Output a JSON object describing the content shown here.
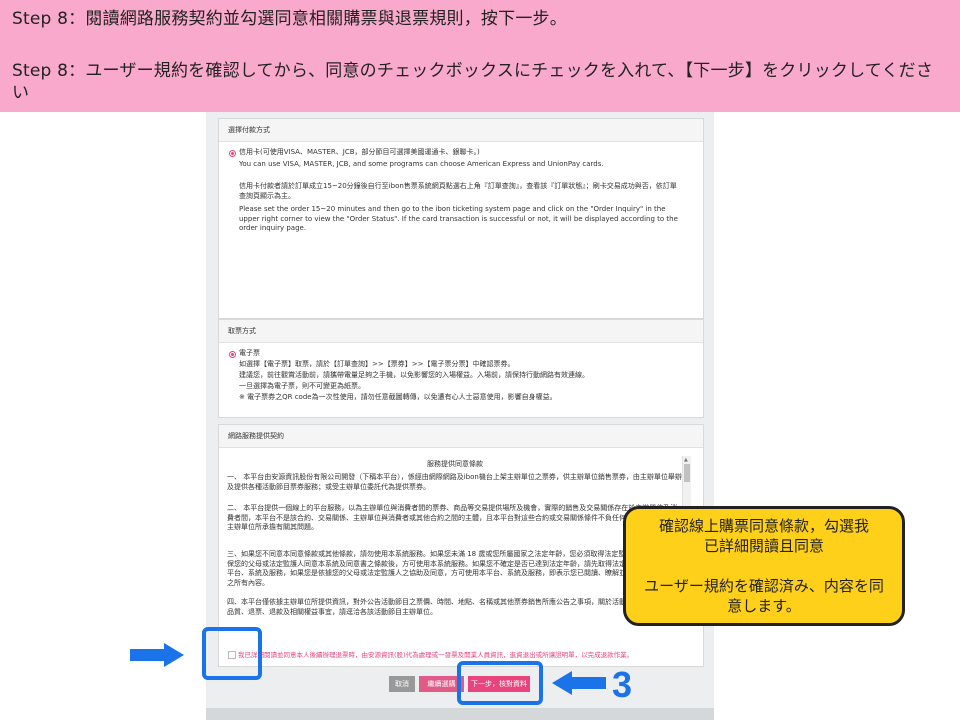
{
  "banner": {
    "line_zh": "Step 8：閱讀網路服務契約並勾選同意相關購票與退票規則，按下一步。",
    "line_ja": "Step 8：ユーザー規約を確認してから、同意のチェックボックスにチェックを入れて、【下一步】をクリックしてください"
  },
  "payment": {
    "header": "選擇付款方式",
    "option_label": "信用卡(可使用VISA、MASTER、JCB，部分節目可選擇美國運通卡、銀聯卡。)",
    "note_en": "You can use VISA, MASTER, JCB, and some programs can choose American Express and UnionPay cards.",
    "note_zh": "信用卡付款者請於訂單成立15~20分鐘後自行至ibon售票系統網頁點選右上角『訂單查詢』，查看該『訂單狀態』；刷卡交易成功與否，依訂單查詢頁顯示為主。",
    "note_en2": "Please set the order 15~20 minutes and then go to the ibon ticketing system page and click on the \"Order Inquiry\" in the upper right corner to view the \"Order Status\". If the card transaction is successful or not, it will be displayed according to the order inquiry page."
  },
  "pickup": {
    "header": "取票方式",
    "option_label": "電子票",
    "line1": "如選擇【電子票】取票，請於【訂單查詢】>>【票券】>>【電子票分票】中確認票券。",
    "line2": "建議您，前往觀賞活動前，請攜帶電量足夠之手機，以免影響您的入場權益。入場前，請保持行動網路有效連線。",
    "line3": "一旦選擇為電子票，則不可變更為紙票。",
    "line4": "※ 電子票券之QR code為一次性使用，請勿任意截圖轉傳，以免遭有心人士惡意使用，影響自身權益。"
  },
  "contract": {
    "header": "網路服務提供契約",
    "doc_title": "服務提供同意條款",
    "para1": "一、 本平台由安源資訊股份有限公司開發（下稱本平台），係經由網際網路及ibon機台上架主辦單位之票券，供主辦單位銷售票券，由主辦單位舉辦及提供各種活動節目票券服務；或受主辦單位委託代為提供票券。",
    "para2": "二、 本平台提供一個線上的平台服務，以為主辦單位與消費者間的票券、商品等交易提供場所及機會，實際的銷售及交易關係存在於主辦單位及消費者間，本平台不是該合約、交易關係、主辦單位與消費者或其他合約之間的主體，且本平台對這些合約或交易關係條件不負任何責任。本平台係經主辦單位所承擔有關其問題。",
    "para3": "三、如果您不同意本同意條款或其他條款，請勿使用本系統服務。如果您未滿 18 歲或您所屬國家之法定年齡，您必須取得法定監護人之許可，並確保您的父母或法定監護人同意本系統及同意書之條款後，方可使用本系統服務。如果您不確定是否已達到法定年齡，請先取得法定監護人之同意。本平台、系統及服務，如果您是依據您的父母或法定監護人之協助及同意，方可使用本平台、系統及服務，即表示您已閱讀、瞭解並同意接受本同意書之所有內容。",
    "para4": "四、本平台僅依據主辦單位所提供資訊，對外公告活動節目之票價、時間、地點、名稱或其他票券銷售所應公告之事項，關於活動節目本身之內容、品質、退票、退款及相關權益事宜，請逕洽各該活動節目主辦單位。",
    "agree_text": "我已詳細閱讀並同意本人後續辦理退票時，由安源資訊(股)代為處理或一發票及開業人員資訊，進資退出或所讓證明單，以完成退款作業。"
  },
  "buttons": {
    "cancel": "取消",
    "continue": "繼續選購",
    "next": "下一步，核對資料"
  },
  "annotation": {
    "step_number": "3",
    "callout_zh": "確認線上購票同意條款，勾選我已詳細閱讀且同意",
    "callout_ja": "ユーザー規約を確認済み、内容を同意します。",
    "accent_color": "#1a73e8",
    "callout_color": "#ffd01a"
  }
}
